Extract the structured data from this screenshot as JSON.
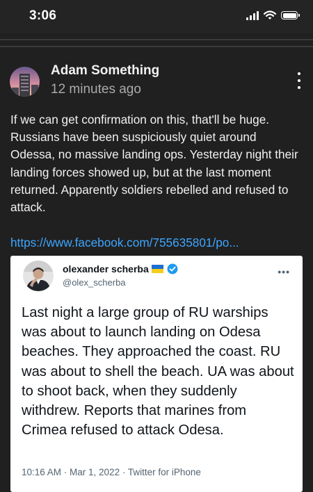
{
  "status_bar": {
    "time": "3:06",
    "icons": [
      "signal-icon",
      "wifi-icon",
      "battery-icon"
    ]
  },
  "post": {
    "author": "Adam Something",
    "timestamp": "12 minutes ago",
    "body": "If we can get confirmation on this, that'll be huge. Russians have been suspiciously quiet around Odessa, no massive landing ops. Yesterday night their landing forces showed up, but at the last moment returned. Apparently soldiers rebelled and refused to attack.",
    "link": "https://www.facebook.com/755635801/po..."
  },
  "tweet": {
    "name": "olexander scherba",
    "handle": "@olex_scherba",
    "more": "•••",
    "text": "Last night a large group of RU warships was about to launch landing on Odesa beaches. They approached the coast. RU was about to shell the beach. UA was about to shoot back, when they suddenly withdrew. Reports that marines from Crimea refused to attack Odesa.",
    "meta": "10:16 AM · Mar 1, 2022 · Twitter for iPhone"
  },
  "colors": {
    "background": "#202020",
    "link": "#3ea6ff",
    "verified": "#1d9bf0",
    "flag_blue": "#1e6fd0",
    "flag_yellow": "#f6cd1b"
  }
}
